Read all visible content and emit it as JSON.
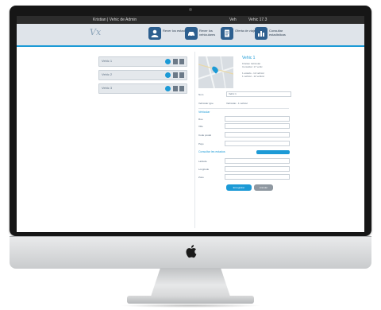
{
  "colors": {
    "accent": "#1c9ad6",
    "navbar_bg": "#dfe4ea",
    "dark_icon": "#2d5f8f"
  },
  "topbar": {
    "left_text": "Kristian | Vehic de Admin",
    "mid_text": "Veh",
    "right_text": "Vehic 17.3"
  },
  "nav": {
    "logo": "Vx",
    "buttons": [
      {
        "label": "Rever los estados",
        "icon": "person-icon"
      },
      {
        "label": "Rever los vehiculares",
        "icon": "car-icon"
      },
      {
        "label": "Oferta de viajes",
        "icon": "document-icon"
      },
      {
        "label": "Consultar estadisticas",
        "icon": "chart-icon"
      }
    ]
  },
  "list": {
    "items": [
      {
        "name": "Vehic 1"
      },
      {
        "name": "Vehic 2"
      },
      {
        "name": "Vehic 3"
      }
    ]
  },
  "detail": {
    "title": "Vehic 1",
    "line1": "Kristian Vehicular",
    "line2": "Consultar: 17 vehic",
    "line3": "1 estado - 12 vehicul",
    "line4": "1 vehicul - 12 vehicul",
    "name_label": "Nom",
    "name_value": "Vehic 1",
    "type_label": "Vehicular type",
    "type_value": "Vehicular - 1 vehicul",
    "section1": "Vehicular",
    "f1": "Rue",
    "f2": "Ville",
    "f3": "Code postal",
    "f4": "Pays",
    "section2": "Consultar les estados",
    "f5": "Latitude",
    "f6": "Longitude",
    "f7": "Zone",
    "save_label": "Enregistrer",
    "cancel_label": "Annuler"
  }
}
